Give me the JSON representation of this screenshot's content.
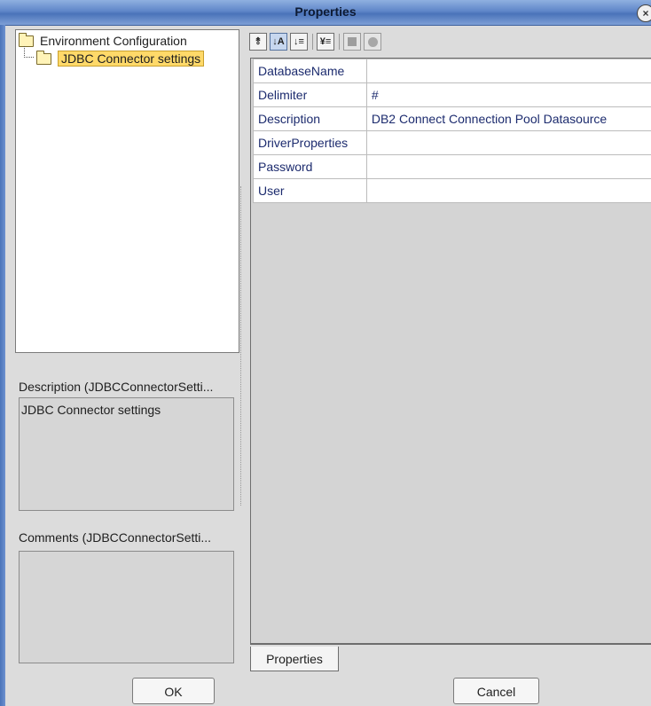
{
  "window": {
    "title": "Properties",
    "close_glyph": "×"
  },
  "tree": {
    "root": {
      "label": "Environment Configuration",
      "icon": "folder-icon"
    },
    "child": {
      "label": "JDBC Connector settings",
      "icon": "folder-icon",
      "selected": true
    }
  },
  "description": {
    "label": "Description (JDBCConnectorSetti...",
    "text": "JDBC Connector settings"
  },
  "comments": {
    "label": "Comments (JDBCConnectorSetti...",
    "text": ""
  },
  "toolbar": {
    "buttons": [
      {
        "name": "expand-all-icon",
        "glyph": "⥉"
      },
      {
        "name": "sort-alphabetical-icon",
        "glyph": "↓A"
      },
      {
        "name": "sort-categorized-icon",
        "glyph": "↓≡"
      },
      {
        "name": "filter-icon",
        "glyph": "¥≡"
      },
      {
        "name": "properties-page-icon",
        "glyph": ""
      },
      {
        "name": "help-icon",
        "glyph": ""
      }
    ]
  },
  "properties": [
    {
      "key": "DatabaseName",
      "value": ""
    },
    {
      "key": "Delimiter",
      "value": "#"
    },
    {
      "key": "Description",
      "value": "DB2 Connect Connection Pool Datasource"
    },
    {
      "key": "DriverProperties",
      "value": ""
    },
    {
      "key": "Password",
      "value": ""
    },
    {
      "key": "User",
      "value": ""
    }
  ],
  "tabs": [
    {
      "label": "Properties",
      "active": true
    }
  ],
  "buttons": {
    "ok": "OK",
    "cancel": "Cancel"
  },
  "colors": {
    "title_gradient_top": "#8fb0e0",
    "title_gradient_bottom": "#4a73b9",
    "selection": "#ffd969",
    "property_text": "#1c2b6e"
  }
}
